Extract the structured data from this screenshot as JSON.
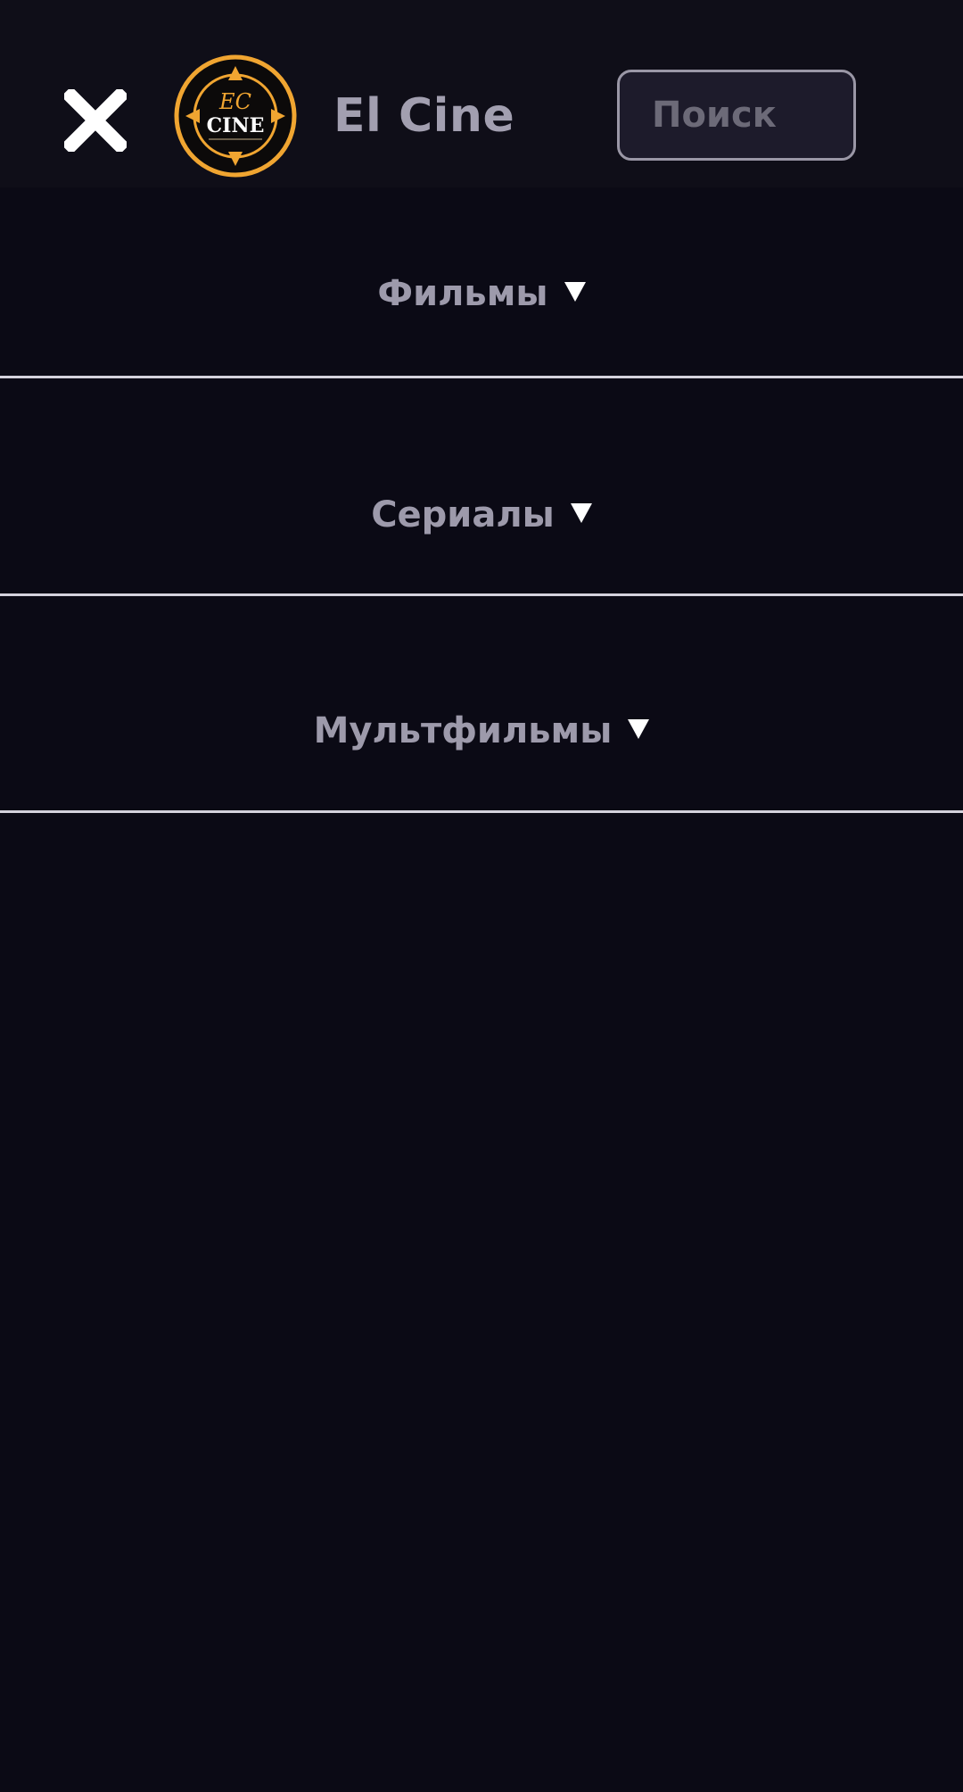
{
  "header": {
    "brand": "El Cine",
    "logo": {
      "icon": "el-cine-compass-logo",
      "text": "CINE",
      "monogram": "EC",
      "accent_color": "#f0a531"
    },
    "close_icon": "close-icon",
    "search": {
      "placeholder": "Поиск"
    }
  },
  "menu": {
    "items": [
      {
        "label": "Фильмы",
        "icon": "caret-down-icon"
      },
      {
        "label": "Сериалы",
        "icon": "caret-down-icon"
      },
      {
        "label": "Мультфильмы",
        "icon": "caret-down-icon"
      }
    ]
  },
  "colors": {
    "background": "#0b0a15",
    "header_background": "#0f0e18",
    "label": "#9d9aab",
    "divider": "#d4d2dc"
  }
}
